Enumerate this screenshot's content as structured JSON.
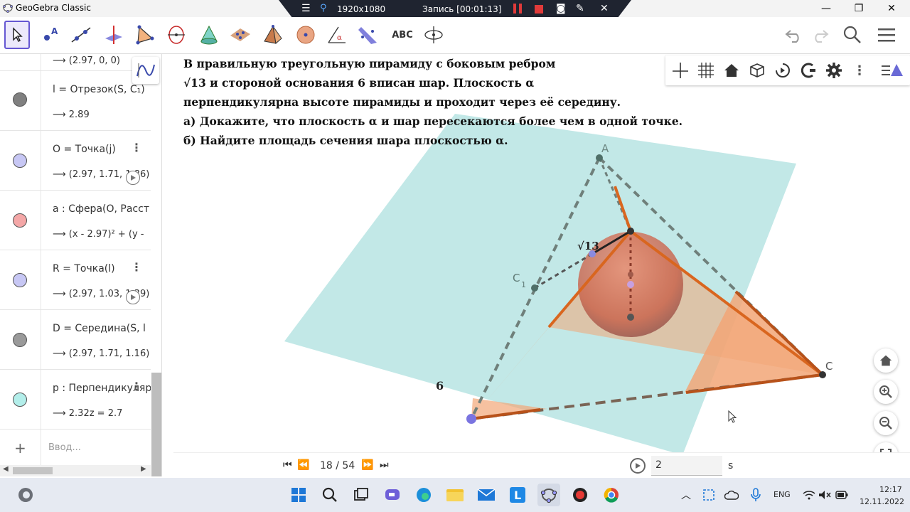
{
  "window": {
    "title": "GeoGebra Classic",
    "minimize": "—",
    "maximize": "❐",
    "close": "✕"
  },
  "recorder": {
    "resolution": "1920x1080",
    "status": "Запись [00:01:13]"
  },
  "toolbar": {
    "abc_label": "ABC",
    "tools": [
      "move-tool",
      "point-tool",
      "line-tool",
      "perpendicular-tool",
      "polygon-tool",
      "circle-axis-tool",
      "intersect-tool",
      "plane-tool",
      "pyramid-tool",
      "sphere-tool",
      "angle-tool",
      "reflect-tool",
      "text-tool",
      "rotate-view-tool"
    ]
  },
  "algebra": {
    "items": [
      {
        "def": "",
        "value": "(2.97, 0, 0)",
        "color": "#ffffff"
      },
      {
        "def": "l = Отрезок(S, C₁)",
        "value": "2.89",
        "color": "#808080"
      },
      {
        "def": "O = Точка(j)",
        "value": "(2.97, 1.71, 1.86)",
        "color": "#c7c7f4"
      },
      {
        "def": "a : Сфера(O, Расст",
        "value": "(x - 2.97)² + (y -",
        "color": "#f4a7a7"
      },
      {
        "def": "R = Точка(l)",
        "value": "(2.97, 1.03, 1.39)",
        "color": "#c7c7f4"
      },
      {
        "def": "D = Середина(S, l",
        "value": "(2.97, 1.71, 1.16)",
        "color": "#9a9a9a"
      },
      {
        "def": "p : Перпендикуляр",
        "value": "2.32z = 2.7",
        "color": "#b3eeea"
      }
    ],
    "input_placeholder": "Ввод...",
    "add_symbol": "+"
  },
  "task": {
    "line1": "В правильную треугольную пирамиду с боковым ребром",
    "line2": "√13 и стороной основания 6 вписан шар. Плоскость α",
    "line3": "перпендикулярна высоте пирамиды и проходит через её середину.",
    "line4": "а) Докажите, что плоскость α и шар пересекаются более чем в одной точке.",
    "line5": "б) Найдите площадь сечения шара плоскостью α."
  },
  "figure": {
    "label_A": "A",
    "label_C": "C",
    "label_C1": "C",
    "label_C1_sub": "1",
    "label_6": "6",
    "label_sqrt13": "√13",
    "plane_color": "#8fd6d3",
    "edge_color": "#d9661f",
    "face_color": "#f2a677",
    "sphere_color": "#c86048"
  },
  "playback": {
    "counter": "18 / 54",
    "speed_value": "2",
    "speed_unit": "s"
  },
  "taskbar": {
    "language": "ENG",
    "time": "12:17",
    "date": "12.11.2022"
  }
}
